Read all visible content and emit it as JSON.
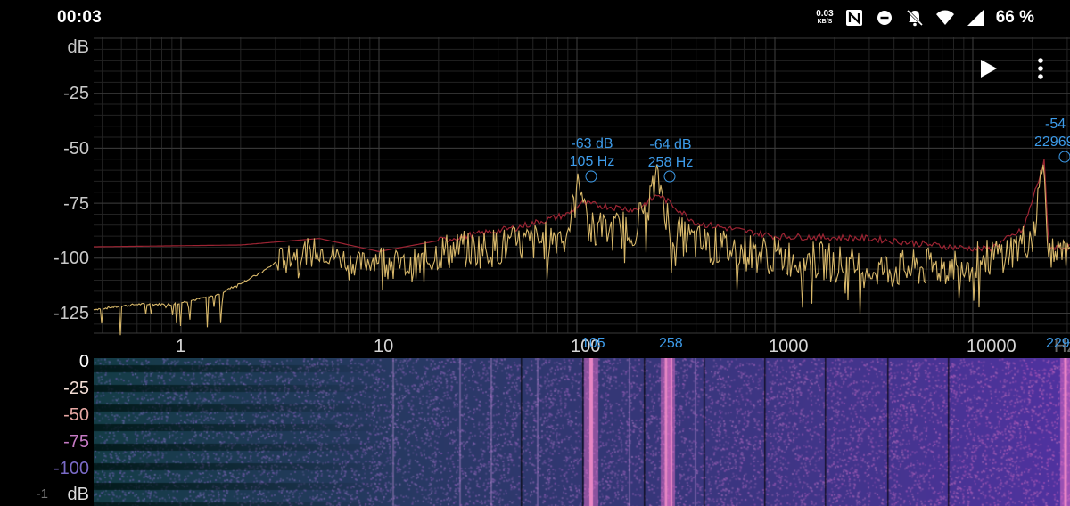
{
  "status_bar": {
    "time": "00:03",
    "net_speed": "0.03",
    "net_unit": "KB/S",
    "battery": "66 %",
    "icons": [
      "nfc-icon",
      "do-not-disturb-icon",
      "notifications-off-icon",
      "wifi-icon",
      "cellular-signal-icon"
    ]
  },
  "toolbar": {
    "play_icon": "play-icon",
    "more_icon": "more-vert-icon"
  },
  "spectrum": {
    "y_unit": "dB",
    "y_ticks": [
      "-25",
      "-50",
      "-75",
      "-100",
      "-125"
    ],
    "x_ticks": [
      "1",
      "10",
      "100",
      "1000",
      "10000"
    ],
    "x_unit_partial": "Hz",
    "peaks": [
      {
        "db": "-63 dB",
        "hz": "105 Hz",
        "x_label": "105"
      },
      {
        "db": "-64 dB",
        "hz": "258 Hz",
        "x_label": "258"
      },
      {
        "db": "-54",
        "hz": "22969",
        "x_label": "229"
      }
    ],
    "colors": {
      "spectrum_line": "#d8b86a",
      "peak_hold_line": "#9c2433",
      "peak_marker": "#3d9be9",
      "grid": "#3a3a3a"
    }
  },
  "spectrogram": {
    "scale_labels": [
      {
        "text": "0",
        "color": "#ffffff"
      },
      {
        "text": "-25",
        "color": "#f1dcd4"
      },
      {
        "text": "-50",
        "color": "#e7a7a3"
      },
      {
        "text": "-75",
        "color": "#c57ac4"
      },
      {
        "text": "-100",
        "color": "#7a6ac7"
      },
      {
        "text": "dB",
        "color": "#dcdcdc"
      }
    ],
    "partial_label": "-1",
    "colors": [
      "#0a3a32",
      "#2e4a78",
      "#6a4fb0",
      "#c24fb0",
      "#ffb0c8"
    ]
  }
}
